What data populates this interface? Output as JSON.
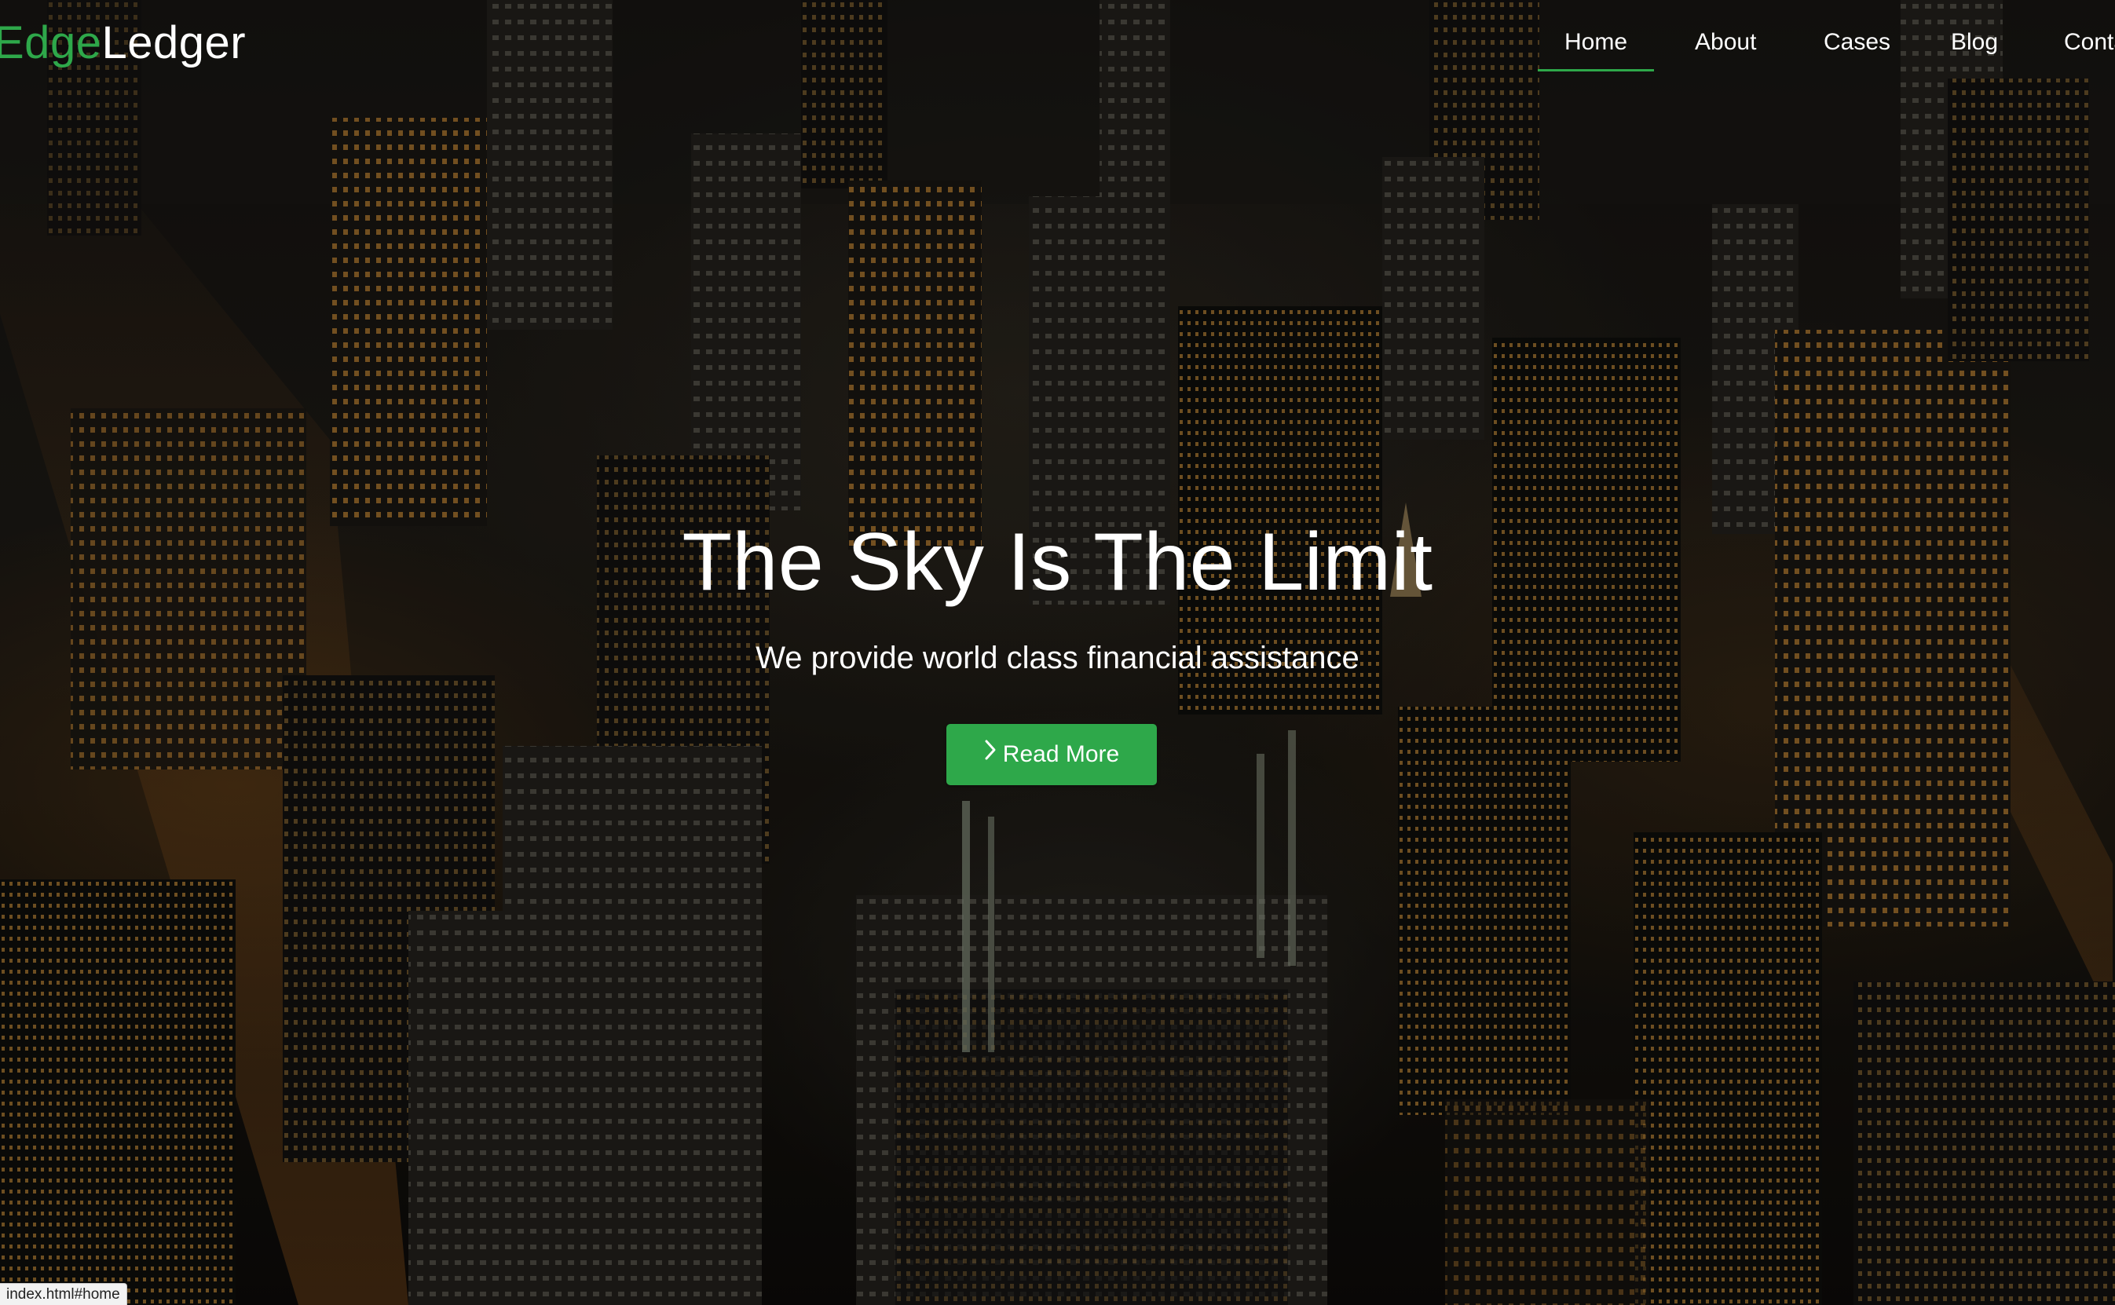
{
  "brand": {
    "accent_part": "Edge",
    "rest_part": "Ledger",
    "accent_color": "#2ea84a"
  },
  "nav": {
    "items": [
      {
        "label": "Home",
        "active": true
      },
      {
        "label": "About"
      },
      {
        "label": "Cases"
      },
      {
        "label": "Blog"
      },
      {
        "label": "Conta"
      }
    ]
  },
  "hero": {
    "title": "The Sky Is The Limit",
    "subtitle": "We provide world class financial assistance",
    "cta_label": "Read More",
    "cta_icon": "chevron-right-icon",
    "cta_color": "#2ea84a",
    "background": "night-city-aerial-photo"
  },
  "status_bar": {
    "url": "index.html#home"
  }
}
